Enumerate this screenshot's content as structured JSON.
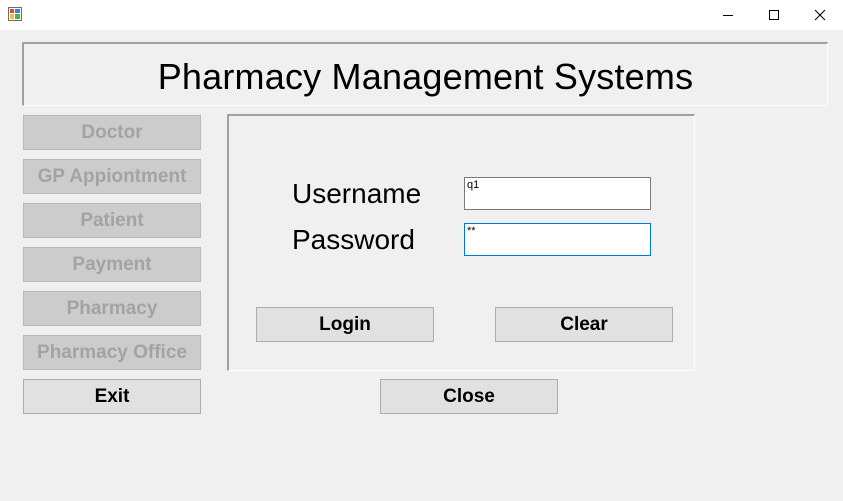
{
  "window": {
    "title": ""
  },
  "header": {
    "title": "Pharmacy Management Systems"
  },
  "sidebar": {
    "items": [
      {
        "label": "Doctor",
        "enabled": false
      },
      {
        "label": "GP Appiontment",
        "enabled": false
      },
      {
        "label": "Patient",
        "enabled": false
      },
      {
        "label": "Payment",
        "enabled": false
      },
      {
        "label": "Pharmacy",
        "enabled": false
      },
      {
        "label": "Pharmacy Office",
        "enabled": false
      },
      {
        "label": "Exit",
        "enabled": true
      }
    ]
  },
  "login": {
    "username_label": "Username",
    "username_value": "q1",
    "password_label": "Password",
    "password_value": "**",
    "login_button": "Login",
    "clear_button": "Clear"
  },
  "close_button": "Close",
  "icons": {
    "app": "app-icon",
    "minimize": "minimize-icon",
    "maximize": "maximize-icon",
    "close": "close-icon"
  }
}
